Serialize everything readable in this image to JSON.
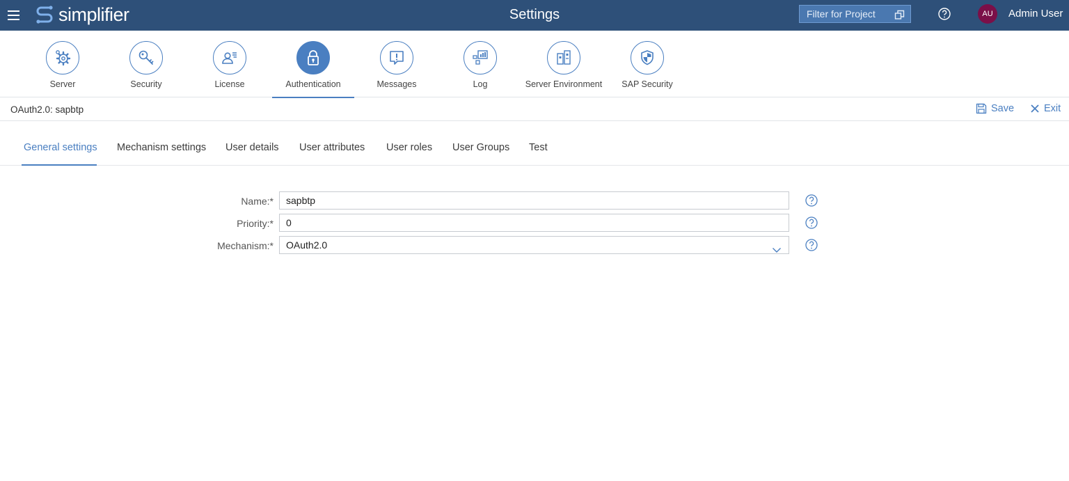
{
  "header": {
    "logo_text": "simplifier",
    "title": "Settings",
    "filter_label": "Filter for Project",
    "avatar_initials": "AU",
    "user_name": "Admin User"
  },
  "categories": [
    {
      "label": "Server",
      "icon": "gear-icon"
    },
    {
      "label": "Security",
      "icon": "key-icon"
    },
    {
      "label": "License",
      "icon": "license-user-icon"
    },
    {
      "label": "Authentication",
      "icon": "lock-icon",
      "active": true
    },
    {
      "label": "Messages",
      "icon": "message-alert-icon"
    },
    {
      "label": "Log",
      "icon": "log-chart-icon"
    },
    {
      "label": "Server Environment",
      "icon": "server-environment-icon"
    },
    {
      "label": "SAP Security",
      "icon": "shield-icon"
    }
  ],
  "subheader": {
    "breadcrumb": "OAuth2.0: sapbtp",
    "save_label": "Save",
    "exit_label": "Exit"
  },
  "tabs": [
    {
      "label": "General settings",
      "active": true
    },
    {
      "label": "Mechanism settings"
    },
    {
      "label": "User details"
    },
    {
      "label": "User attributes"
    },
    {
      "label": "User roles"
    },
    {
      "label": "User Groups"
    },
    {
      "label": "Test"
    }
  ],
  "form": {
    "name_label": "Name:",
    "name_value": "sapbtp",
    "priority_label": "Priority:",
    "priority_value": "0",
    "mechanism_label": "Mechanism:",
    "mechanism_value": "OAuth2.0",
    "required_marker": "*"
  },
  "colors": {
    "header_bg": "#2e5079",
    "accent": "#4a7fc1",
    "avatar_bg": "#7b0f48"
  }
}
